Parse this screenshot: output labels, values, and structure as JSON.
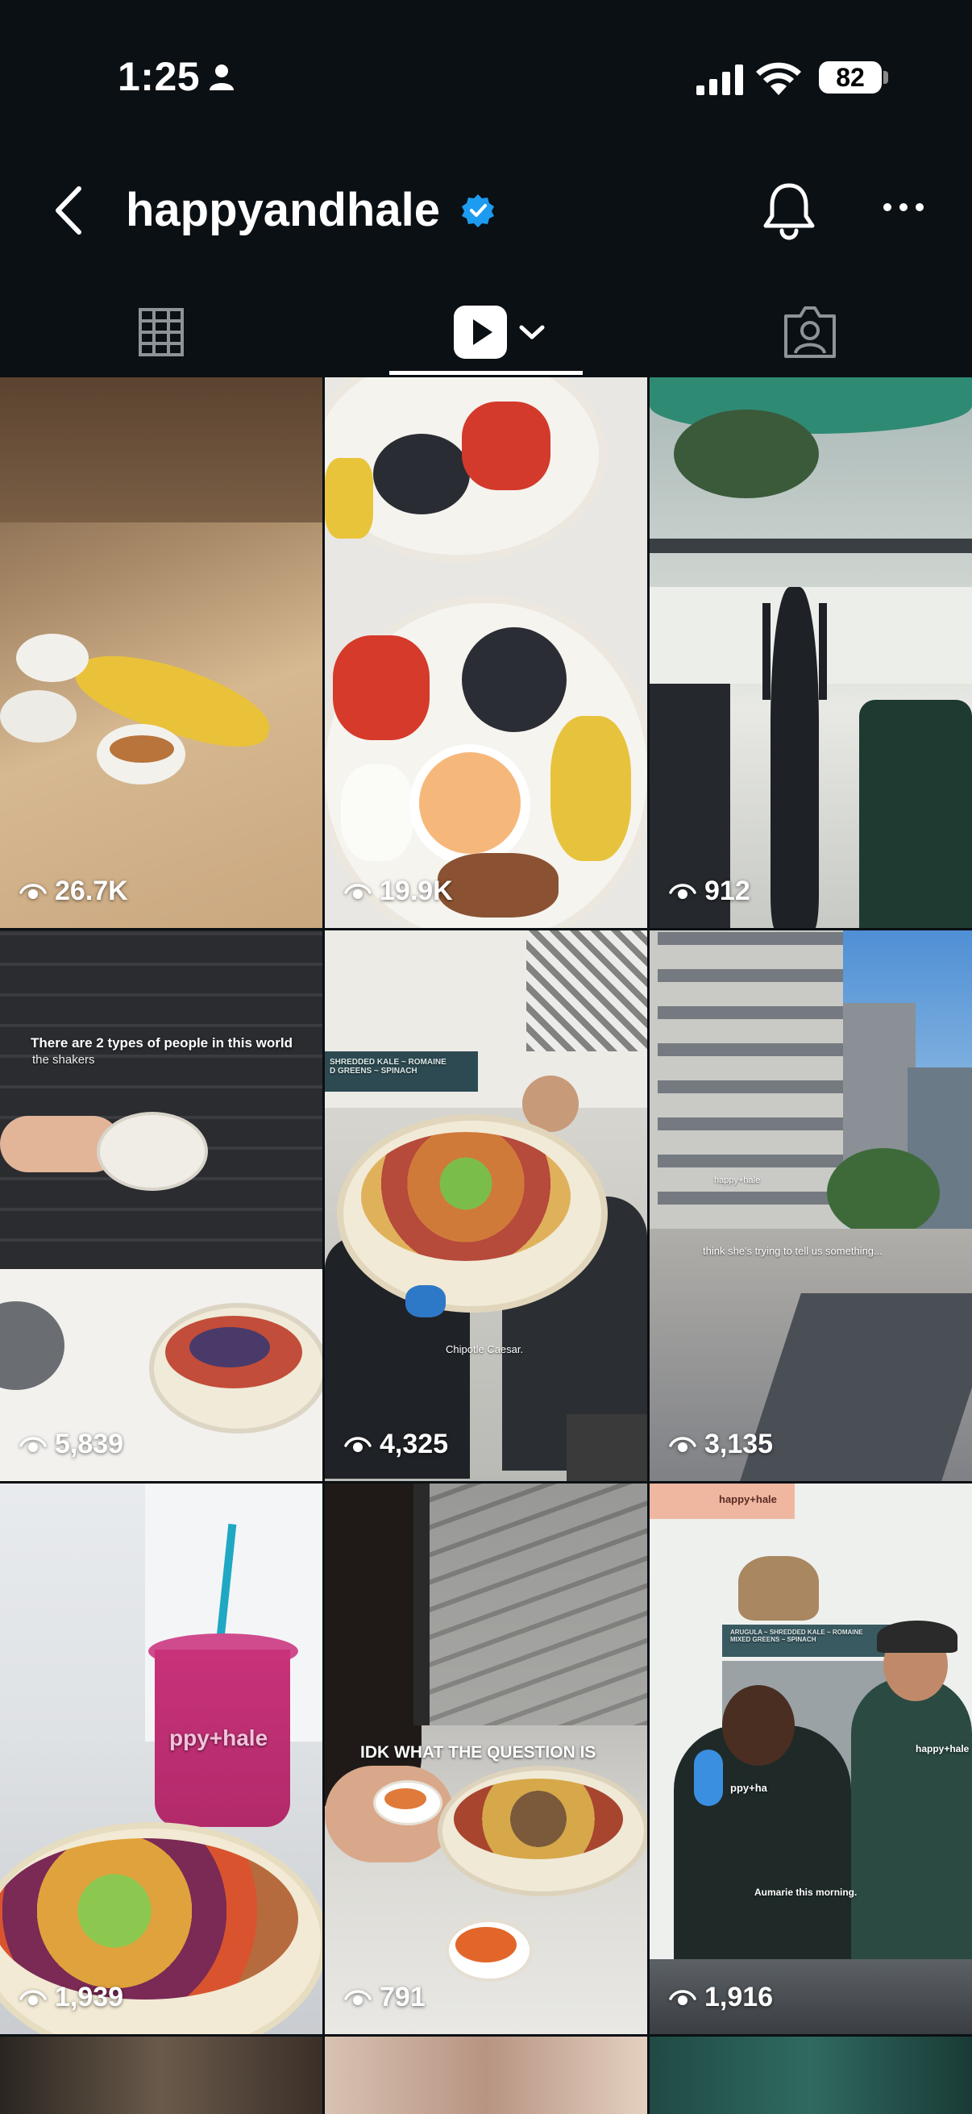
{
  "status_bar": {
    "time": "1:25",
    "battery": "82"
  },
  "header": {
    "username": "happyandhale"
  },
  "reels": [
    {
      "views": "26.7K"
    },
    {
      "views": "19.9K"
    },
    {
      "views": "912"
    },
    {
      "views": "5,839",
      "caption": "There are 2 types of people in this world",
      "subcaption": "the shakers"
    },
    {
      "views": "4,325",
      "caption": "Chipotle Caesar.",
      "sign": "SHREDDED KALE ~ ROMAINE\nD GREENS ~ SPINACH"
    },
    {
      "views": "3,135",
      "caption": "think she's trying to tell us something...",
      "sign": "happy+hale"
    },
    {
      "views": "1,939",
      "cup_text": "ppy+hale"
    },
    {
      "views": "791",
      "caption": "IDK WHAT THE QUESTION IS"
    },
    {
      "views": "1,916",
      "caption": "Aumarie this morning.",
      "banner": "happy+hale",
      "apron": "ppy+ha",
      "shirt": "happy+hale",
      "sign": "ARUGULA ~ SHREDDED KALE ~ ROMAINE\nMIXED GREENS ~ SPINACH"
    }
  ],
  "colors": {
    "background": "#0b1014",
    "verified": "#1d9bf0",
    "text": "#ffffff"
  }
}
